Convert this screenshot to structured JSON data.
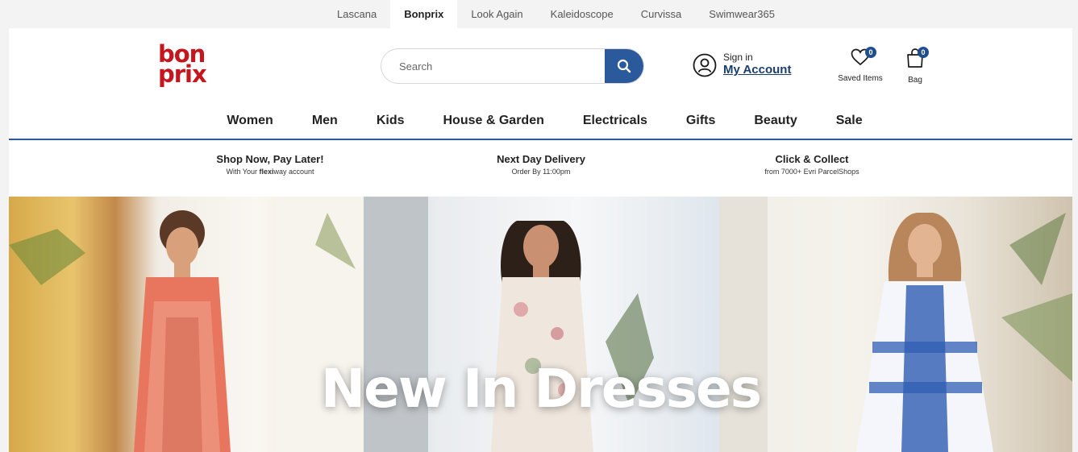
{
  "brand_tabs": [
    {
      "label": "Lascana"
    },
    {
      "label": "Bonprix"
    },
    {
      "label": "Look Again"
    },
    {
      "label": "Kaleidoscope"
    },
    {
      "label": "Curvissa"
    },
    {
      "label": "Swimwear365"
    }
  ],
  "active_brand_index": 1,
  "logo": {
    "line1": "bon",
    "line2": "prix"
  },
  "search": {
    "placeholder": "Search"
  },
  "account": {
    "sign_in": "Sign in",
    "my_account": "My Account"
  },
  "saved_items": {
    "label": "Saved Items",
    "count": "0"
  },
  "bag": {
    "label": "Bag",
    "count": "0"
  },
  "nav": [
    {
      "label": "Women"
    },
    {
      "label": "Men"
    },
    {
      "label": "Kids"
    },
    {
      "label": "House & Garden"
    },
    {
      "label": "Electricals"
    },
    {
      "label": "Gifts"
    },
    {
      "label": "Beauty"
    },
    {
      "label": "Sale"
    }
  ],
  "usp": [
    {
      "title": "Shop Now, Pay Later!",
      "sub_prefix": "With Your ",
      "sub_bold": "flexi",
      "sub_suffix": "way account"
    },
    {
      "title": "Next Day Delivery",
      "sub": "Order By 11:00pm"
    },
    {
      "title": "Click & Collect",
      "sub": "from 7000+ Evri ParcelShops"
    }
  ],
  "hero": {
    "title": "New In Dresses"
  },
  "colors": {
    "brand_red": "#c4161c",
    "accent_blue": "#2a5a9c",
    "badge_blue": "#1f4f8f"
  }
}
